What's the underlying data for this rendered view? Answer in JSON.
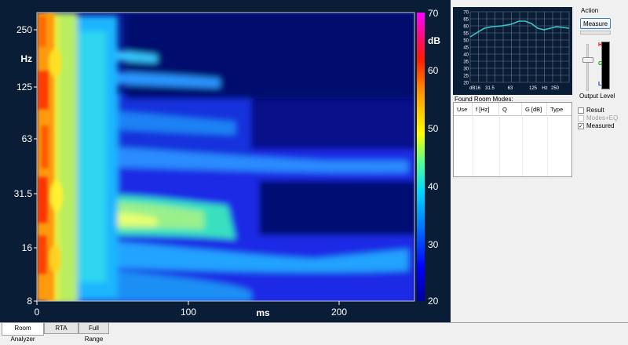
{
  "spectrogram": {
    "y_unit": "Hz",
    "y_ticks": [
      "250",
      "125",
      "63",
      "31.5",
      "16",
      "8"
    ],
    "x_unit": "ms",
    "x_ticks": [
      "0",
      "100",
      "200"
    ],
    "colorbar_unit": "dB",
    "colorbar_ticks": [
      "70",
      "60",
      "50",
      "40",
      "30",
      "20"
    ]
  },
  "mini_chart": {
    "y_ticks": [
      "70",
      "65",
      "60",
      "55",
      "50",
      "45",
      "40",
      "35",
      "30",
      "25",
      "20"
    ],
    "y_unit": "dB",
    "x_ticks": [
      "16",
      "31.5",
      "63",
      "125",
      "250"
    ],
    "x_unit": "Hz",
    "line_color": "#33c9c9"
  },
  "room_modes": {
    "title": "Found Room Modes:",
    "columns": [
      "Use",
      "f [Hz]",
      "Q",
      "G [dB]",
      "Type"
    ]
  },
  "action": {
    "label": "Action",
    "measure_button": "Measure",
    "output_level_label": "Output Level",
    "meter_letters": [
      "H",
      "G",
      "L"
    ]
  },
  "options": {
    "result": {
      "label": "Result",
      "checked": false
    },
    "modes_eq": {
      "label": "Modes+EQ",
      "checked": false,
      "disabled": true
    },
    "measured": {
      "label": "Measured",
      "checked": true
    }
  },
  "tabs": [
    "Room Analyzer",
    "RTA",
    "Full Range"
  ],
  "colors": {
    "panel_bg": "#0a1d36",
    "colormap": [
      "#000099",
      "#0000ff",
      "#0080ff",
      "#00e5ff",
      "#66ff66",
      "#ffff00",
      "#ffa000",
      "#ff2000",
      "#ff00ff"
    ]
  }
}
